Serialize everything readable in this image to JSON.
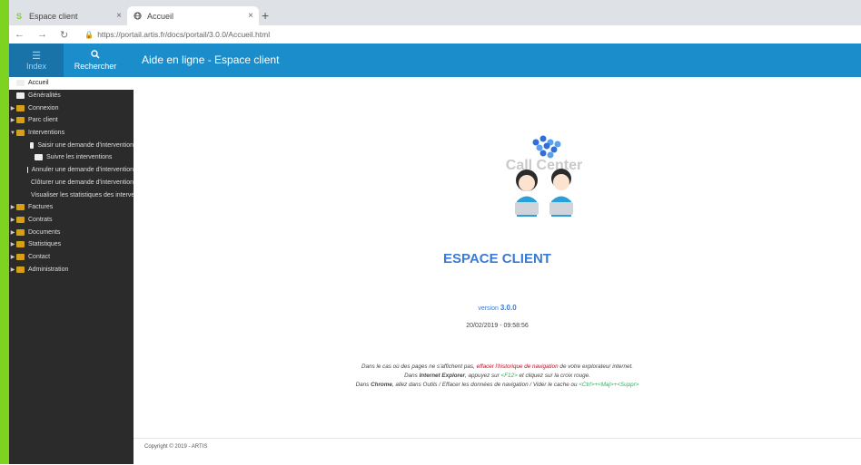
{
  "browser": {
    "tabs": [
      {
        "title": "Espace client",
        "active": false
      },
      {
        "title": "Accueil",
        "active": true
      }
    ],
    "new_tab": "+",
    "close_glyph": "×",
    "url": "https://portail.artis.fr/docs/portail/3.0.0/Accueil.html"
  },
  "header": {
    "index_label": "Index",
    "search_label": "Rechercher",
    "title": "Aide en ligne - Espace client"
  },
  "sidebar": {
    "items": [
      {
        "label": "Accueil",
        "type": "doc",
        "level": 0,
        "arrow": "",
        "selected": true
      },
      {
        "label": "Généralités",
        "type": "doc",
        "level": 0,
        "arrow": ""
      },
      {
        "label": "Connexion",
        "type": "folder",
        "level": 0,
        "arrow": "▶"
      },
      {
        "label": "Parc client",
        "type": "folder",
        "level": 0,
        "arrow": "▶"
      },
      {
        "label": "Interventions",
        "type": "folder",
        "level": 0,
        "arrow": "▼"
      },
      {
        "label": "Saisir une demande d'intervention",
        "type": "doc",
        "level": 1,
        "arrow": ""
      },
      {
        "label": "Suivre les interventions",
        "type": "doc",
        "level": 1,
        "arrow": ""
      },
      {
        "label": "Annuler une demande d'intervention",
        "type": "doc",
        "level": 1,
        "arrow": ""
      },
      {
        "label": "Clôturer une demande d'intervention",
        "type": "doc",
        "level": 1,
        "arrow": ""
      },
      {
        "label": "Visualiser les statistiques des interventions",
        "type": "doc",
        "level": 1,
        "arrow": ""
      },
      {
        "label": "Factures",
        "type": "folder",
        "level": 0,
        "arrow": "▶"
      },
      {
        "label": "Contrats",
        "type": "folder",
        "level": 0,
        "arrow": "▶"
      },
      {
        "label": "Documents",
        "type": "folder",
        "level": 0,
        "arrow": "▶"
      },
      {
        "label": "Statistiques",
        "type": "folder",
        "level": 0,
        "arrow": "▶"
      },
      {
        "label": "Contact",
        "type": "folder",
        "level": 0,
        "arrow": "▶"
      },
      {
        "label": "Administration",
        "type": "folder",
        "level": 0,
        "arrow": "▶"
      }
    ]
  },
  "main": {
    "logo_text": "Call Center",
    "title": "ESPACE CLIENT",
    "version_label": "version",
    "version_number": "3.0.0",
    "datetime": "20/02/2019 - 09:58:56",
    "notice": {
      "line1_a": "Dans le cas où des pages ne s'affichent pas, ",
      "line1_link": "effacer l'historique de navigation",
      "line1_b": " de votre explorateur internet.",
      "line2_a": "Dans ",
      "line2_bold": "Internet Explorer",
      "line2_b": ", appuyez sur ",
      "line2_key": "<F12>",
      "line2_c": " et cliquez sur la croix rouge.",
      "line3_a": "Dans ",
      "line3_bold": "Chrome",
      "line3_b": ", allez dans Outils / Effacer les données de navigation / Vider le cache ou ",
      "line3_key": "<Ctrl>+<Maj>+<Suppr>"
    },
    "footer": "Copyright © 2019 - ARTIS"
  },
  "colors": {
    "header_blue": "#1b8dcb",
    "sidebar_dark": "#2b2b2b",
    "title_blue": "#3a7bd5",
    "accent_green": "#7ed321"
  }
}
